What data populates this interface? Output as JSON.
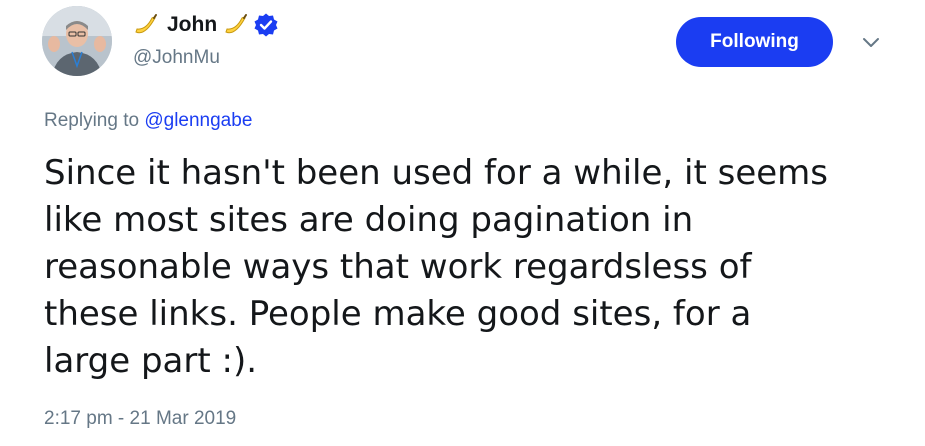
{
  "author": {
    "display_name": "John",
    "handle": "@JohnMu",
    "verified_icon": "verified-badge-icon",
    "name_emoji": "banana-icon",
    "avatar_icon": "avatar"
  },
  "follow_button": {
    "label": "Following"
  },
  "menu": {
    "icon": "chevron-down-icon"
  },
  "reply_context": {
    "prefix": "Replying to",
    "mention": "@glenngabe"
  },
  "tweet": {
    "text": "Since it hasn't been used for a while, it seems\nlike most sites are doing pagination in\nreasonable ways that work regardsless of\nthese links. People make good sites, for a\nlarge part :).",
    "timestamp": "2:17 pm - 21 Mar 2019"
  },
  "colors": {
    "accent": "#1b3df2",
    "muted": "#657786",
    "text": "#14171a",
    "banana": "#ffd23f"
  }
}
